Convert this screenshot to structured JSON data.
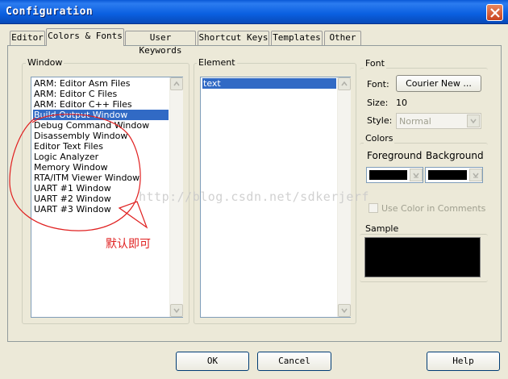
{
  "window": {
    "title": "Configuration"
  },
  "tabs": [
    {
      "label": "Editor"
    },
    {
      "label": "Colors & Fonts"
    },
    {
      "label": "User Keywords"
    },
    {
      "label": "Shortcut Keys"
    },
    {
      "label": "Templates"
    },
    {
      "label": "Other"
    }
  ],
  "active_tab": "Colors & Fonts",
  "window_group": {
    "label": "Window",
    "items": [
      "ARM: Editor Asm Files",
      "ARM: Editor C Files",
      "ARM: Editor C++ Files",
      "Build Output Window",
      "Debug Command Window",
      "Disassembly Window",
      "Editor Text Files",
      "Logic Analyzer",
      "Memory Window",
      "RTA/ITM Viewer Window",
      "UART #1 Window",
      "UART #2 Window",
      "UART #3 Window"
    ],
    "selected": "Build Output Window"
  },
  "element_group": {
    "label": "Element",
    "items": [
      "text"
    ],
    "selected": "text"
  },
  "font_group": {
    "label": "Font",
    "font_label": "Font:",
    "font_button": "Courier New ...",
    "size_label": "Size:",
    "size_value": "10",
    "style_label": "Style:",
    "style_value": "Normal"
  },
  "colors_group": {
    "label": "Colors",
    "foreground_label": "Foreground",
    "background_label": "Background",
    "foreground_color": "#000000",
    "background_color": "#000000",
    "use_color_label": "Use Color in Comments"
  },
  "sample_group": {
    "label": "Sample"
  },
  "annotation": {
    "watermark": "http://blog.csdn.net/sdkerjerf",
    "note": "默认即可"
  },
  "footer": {
    "ok": "OK",
    "cancel": "Cancel",
    "help": "Help"
  }
}
